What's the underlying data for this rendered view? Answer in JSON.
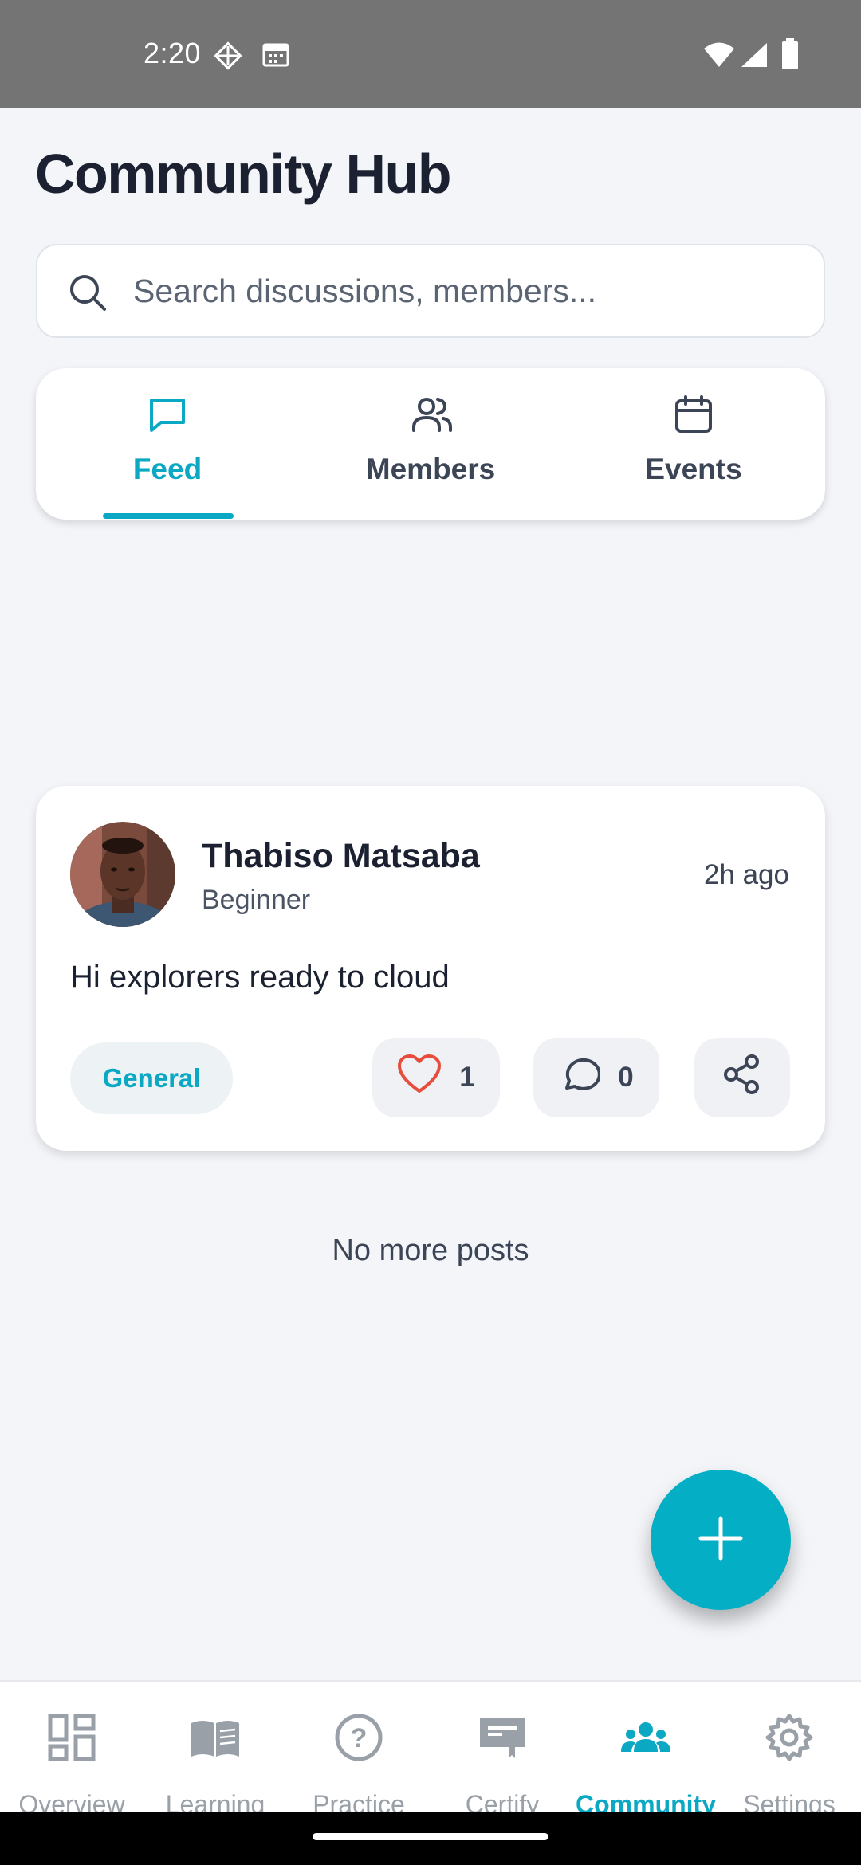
{
  "status_bar": {
    "time": "2:20"
  },
  "page": {
    "title": "Community Hub"
  },
  "search": {
    "placeholder": "Search discussions, members..."
  },
  "tabs": [
    {
      "label": "Feed",
      "icon": "message-square-icon",
      "active": true
    },
    {
      "label": "Members",
      "icon": "users-icon",
      "active": false
    },
    {
      "label": "Events",
      "icon": "calendar-icon",
      "active": false
    }
  ],
  "post": {
    "author": "Thabiso Matsaba",
    "level": "Beginner",
    "time_ago": "2h ago",
    "content": "Hi explorers ready to cloud",
    "tag": "General",
    "likes": "1",
    "comments": "0"
  },
  "feed_end_text": "No more posts",
  "bottom_nav": [
    {
      "label": "Overview",
      "icon": "dashboard-icon",
      "active": false
    },
    {
      "label": "Learning",
      "icon": "book-icon",
      "active": false
    },
    {
      "label": "Practice",
      "icon": "help-circle-icon",
      "active": false
    },
    {
      "label": "Certify",
      "icon": "certificate-icon",
      "active": false
    },
    {
      "label": "Community",
      "icon": "people-icon",
      "active": true
    },
    {
      "label": "Settings",
      "icon": "gear-icon",
      "active": false
    }
  ],
  "colors": {
    "accent": "#0aa8c3",
    "background": "#f3f5f9",
    "status_bar": "#747474",
    "like": "#e74c3c"
  }
}
